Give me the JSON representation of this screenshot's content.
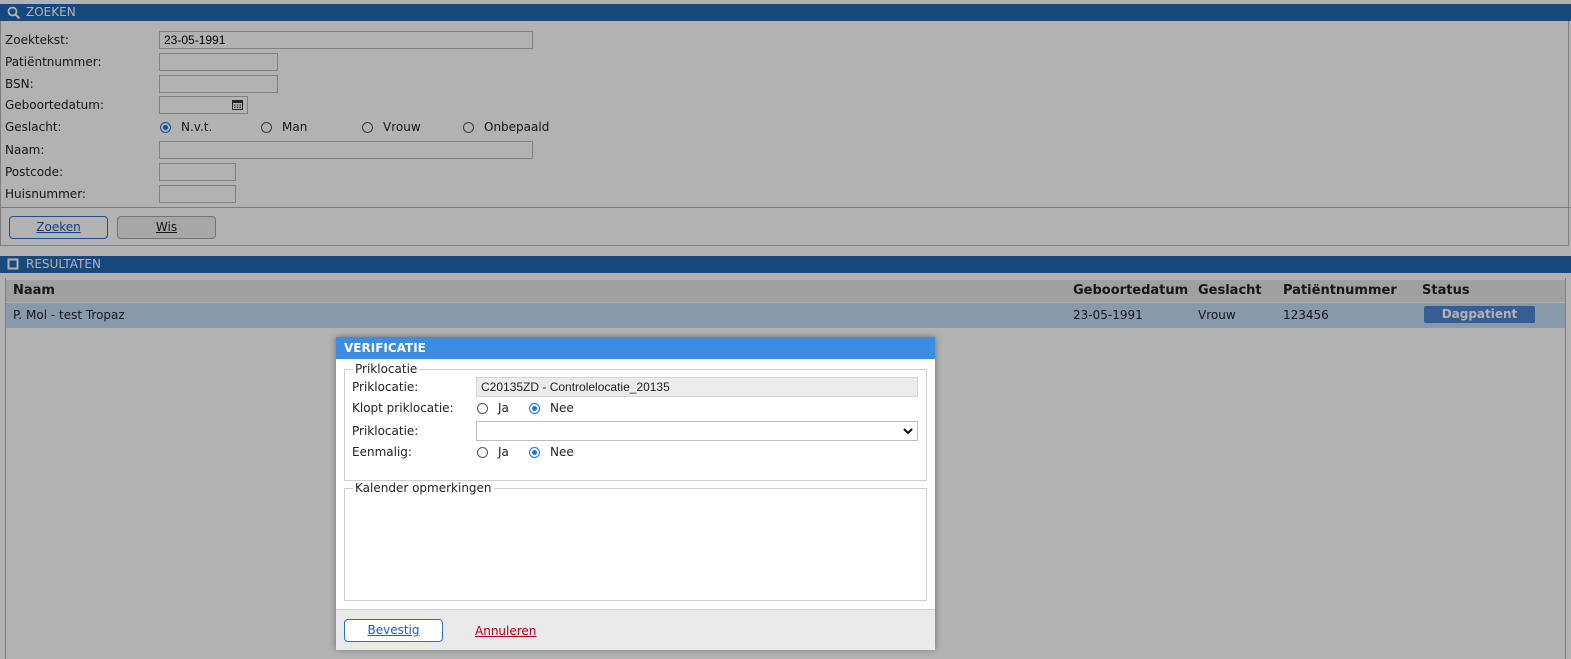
{
  "search": {
    "title": "ZOEKEN",
    "fields": {
      "zoektekst_label": "Zoekteks t:",
      "zoektekst_value": "23-05-1991",
      "patientnummer_label": "Patiëntnummer:",
      "bsn_label": "BSN:",
      "geboortedatum_label": "Geboortedatum:",
      "geslacht_label": "Geslacht:",
      "naam_label": "Naam:",
      "postcode_label": "Postcode:",
      "huisnummer_label": "Huisnummer:"
    },
    "gender_options": [
      "N.v.t.",
      "Man",
      "Vrouw",
      "Onbepaald"
    ],
    "gender_selected": "N.v.t.",
    "buttons": {
      "search": "Zoeken",
      "clear": "Wis"
    }
  },
  "results": {
    "title": "RESULTATEN",
    "columns": [
      "Naam",
      "Geboortedatum",
      "Geslacht",
      "Patiëntnummer",
      "Status"
    ],
    "rows": [
      {
        "naam": "P. Mol - test Tropaz",
        "geboortedatum": "23-05-1991",
        "geslacht": "Vrouw",
        "patientnummer": "123456",
        "status": "Dagpatient"
      }
    ]
  },
  "modal": {
    "title": "VERIFICATIE",
    "fieldset1_legend": "Priklocatie",
    "priklocatie_label": "Priklocatie:",
    "priklocatie_value": "C20135ZD - Controlelocatie_20135",
    "klopt_label": "Klopt priklocatie:",
    "ja_label": "Ja",
    "nee_label": "Nee",
    "priklocatie2_label": "Priklocatie:",
    "priklocatie2_value": "",
    "eenmalig_label": "Eenmalig:",
    "fieldset2_legend": "Kalender opmerkingen",
    "confirm_label": "Bevestig",
    "cancel_label": "Annuleren"
  },
  "colors": {
    "header_blue": "#2369b3",
    "modal_header": "#3a8de0",
    "status_badge": "#4f86d6",
    "cancel_red": "#b00020"
  }
}
